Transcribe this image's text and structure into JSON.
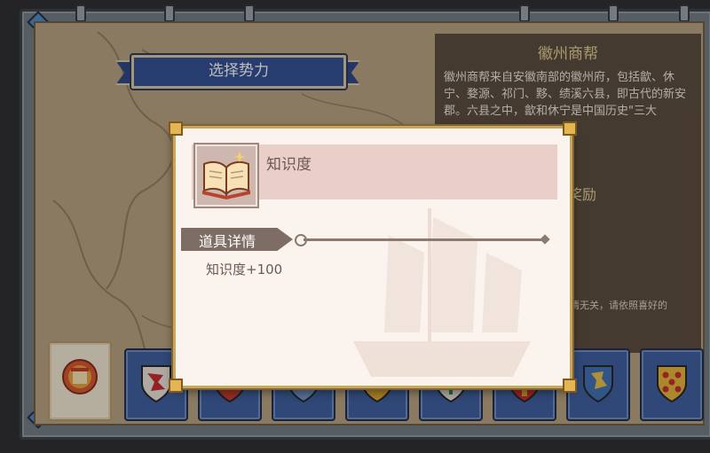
{
  "header": {
    "select_power_label": "选择势力"
  },
  "faction_info": {
    "name": "徽州商帮",
    "description": "徽州商帮来自安徽南部的徽州府，包括歙、休宁、婺源、祁门、黟、绩溪六县，即古代的新安郡。六县之中，歙和休宁是中国历史\"三大",
    "reward_title": "奖励",
    "note": "情无关，请依照喜好的"
  },
  "faction_tabs": [
    {
      "icon": "gate-crest-icon",
      "active": true
    },
    {
      "icon": "red-dragon-shield-icon",
      "active": false
    },
    {
      "icon": "green-wreath-shield-icon",
      "active": false
    },
    {
      "icon": "blue-dots-shield-icon",
      "active": false
    },
    {
      "icon": "red-gold-shield-icon",
      "active": false
    },
    {
      "icon": "green-tree-shield-icon",
      "active": false
    },
    {
      "icon": "red-cross-shield-icon",
      "active": false
    },
    {
      "icon": "blue-lion-shield-icon",
      "active": false
    },
    {
      "icon": "gold-red-dots-shield-icon",
      "active": false
    }
  ],
  "item_popup": {
    "item_name": "知识度",
    "item_icon": "open-book-icon",
    "section_label": "道具详情",
    "description": "知识度+100"
  },
  "colors": {
    "banner_blue": "#2f4e96",
    "popup_background": "#fbf4ee",
    "popup_header": "#e9cfc7",
    "info_title_gold": "#e6cf99"
  }
}
